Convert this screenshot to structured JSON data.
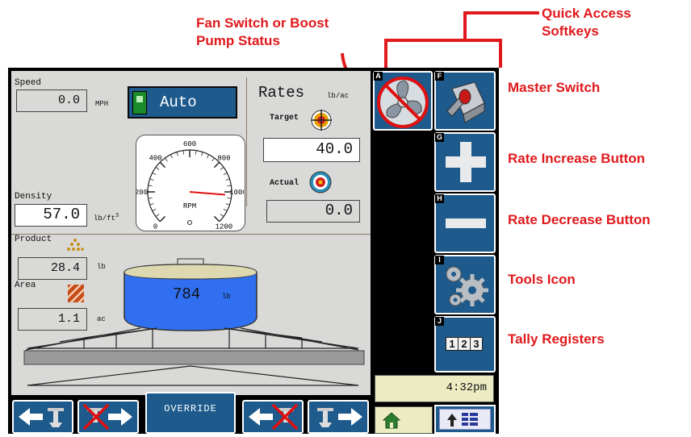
{
  "callouts": {
    "fan_switch": "Fan Switch or Boost\nPump Status",
    "quick_access": "Quick Access\nSoftkeys",
    "master_switch": "Master Switch",
    "rate_increase": "Rate Increase Button",
    "rate_decrease": "Rate Decrease Button",
    "tools": "Tools Icon",
    "tally": "Tally Registers"
  },
  "speed": {
    "label": "Speed",
    "value": "0.0",
    "unit": "MPH"
  },
  "mode": {
    "label": "Auto"
  },
  "rates": {
    "title": "Rates",
    "unit": "lb/ac",
    "target_label": "Target",
    "target_value": "40.0",
    "actual_label": "Actual",
    "actual_value": "0.0"
  },
  "gauge": {
    "ticks": [
      "0",
      "200",
      "400",
      "600",
      "800",
      "1000",
      "1200"
    ],
    "label": "RPM",
    "needle_value": 1020,
    "max": 1200
  },
  "density": {
    "label": "Density",
    "value": "57.0",
    "unit": "lb/ft",
    "unit_sup": "3"
  },
  "product": {
    "label": "Product",
    "value": "28.4",
    "unit": "lb"
  },
  "area": {
    "label": "Area",
    "value": "1.1",
    "unit": "ac"
  },
  "tank": {
    "value": "784",
    "unit": "lb"
  },
  "softkeys": [
    {
      "letter": "A",
      "icon": "fan-icon",
      "status": "off"
    },
    {
      "letter": "F",
      "icon": "master-switch-icon"
    },
    {
      "letter": "G",
      "icon": "plus-icon"
    },
    {
      "letter": "H",
      "icon": "minus-icon"
    },
    {
      "letter": "I",
      "icon": "gears-icon"
    },
    {
      "letter": "J",
      "icon": "tally-icon",
      "digits": [
        "1",
        "2",
        "3"
      ]
    }
  ],
  "clock": "4:32pm",
  "bottom": {
    "override_label": "OVERRIDE"
  },
  "colors": {
    "softkey_blue": "#1e5a8c",
    "callout_red": "#e0191c",
    "panel_gray": "#d9d9d7",
    "clock_bg": "#ecebc2",
    "tank_blue": "#2f6ff0"
  }
}
